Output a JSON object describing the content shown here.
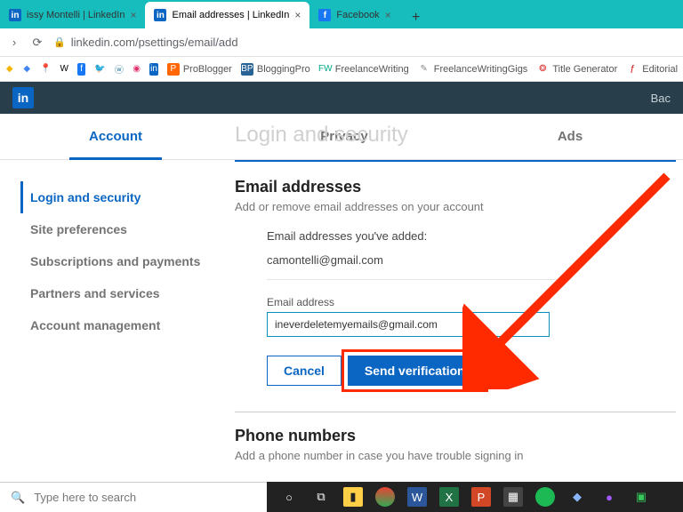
{
  "browser": {
    "tabs": [
      {
        "title": "issy Montelli | LinkedIn",
        "active": false,
        "favicon": "in"
      },
      {
        "title": "Email addresses | LinkedIn",
        "active": true,
        "favicon": "in"
      },
      {
        "title": "Facebook",
        "active": false,
        "favicon": "f"
      }
    ],
    "url": "linkedin.com/psettings/email/add",
    "bookmarks": [
      "ProBlogger",
      "BloggingPro",
      "FreelanceWriting",
      "FreelanceWritingGigs",
      "Title Generator",
      "Editorial"
    ]
  },
  "header": {
    "back": "Bac"
  },
  "top_tabs": [
    "Account",
    "Privacy",
    "Ads"
  ],
  "ghost_heading": "Login and security",
  "sidebar": {
    "items": [
      "Login and security",
      "Site preferences",
      "Subscriptions and payments",
      "Partners and services",
      "Account management"
    ]
  },
  "email_section": {
    "title": "Email addresses",
    "subtitle": "Add or remove email addresses on your account",
    "added_label": "Email addresses you've added:",
    "existing": "camontelli@gmail.com",
    "input_label": "Email address",
    "input_value": "ineverdeletemyemails@gmail.com",
    "cancel": "Cancel",
    "send": "Send verification"
  },
  "phone_section": {
    "title": "Phone numbers",
    "subtitle": "Add a phone number in case you have trouble signing in"
  },
  "taskbar": {
    "search_placeholder": "Type here to search"
  },
  "colors": {
    "accent": "#0a66c2",
    "annotation": "#ff2a00"
  }
}
